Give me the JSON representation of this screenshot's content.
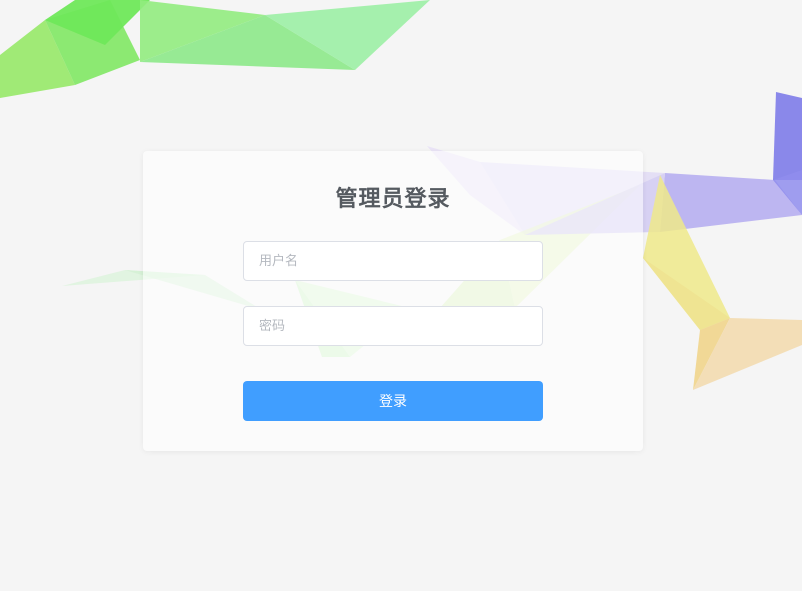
{
  "login": {
    "title": "管理员登录",
    "username_placeholder": "用户名",
    "username_value": "",
    "password_placeholder": "密码",
    "password_value": "",
    "submit_label": "登录"
  },
  "colors": {
    "page_background": "#f5f5f5",
    "title_text": "#555a60",
    "button_primary": "#409eff",
    "input_border": "#dcdfe6"
  }
}
